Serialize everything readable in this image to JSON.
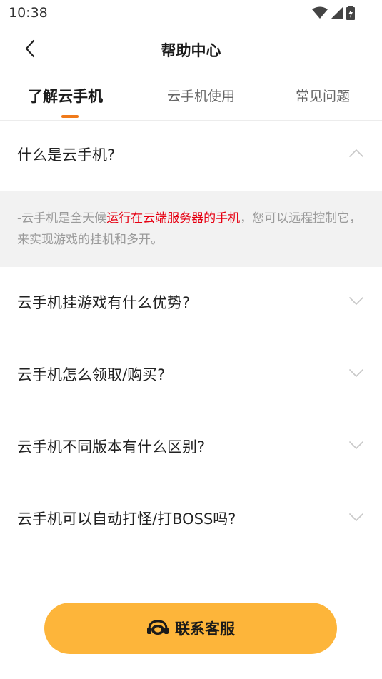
{
  "status_bar": {
    "time": "10:38"
  },
  "nav": {
    "title": "帮助中心"
  },
  "tabs": [
    {
      "label": "了解云手机",
      "active": true
    },
    {
      "label": "云手机使用",
      "active": false
    },
    {
      "label": "常见问题",
      "active": false
    }
  ],
  "faq": [
    {
      "question": "什么是云手机?",
      "expanded": true,
      "answer": {
        "prefix": "-云手机是全天候",
        "highlight": "运行在云端服务器的手机",
        "suffix": "，您可以远程控制它，来实现游戏的挂机和多开。"
      }
    },
    {
      "question": "云手机挂游戏有什么优势?",
      "expanded": false
    },
    {
      "question": "云手机怎么领取/购买?",
      "expanded": false
    },
    {
      "question": "云手机不同版本有什么区别?",
      "expanded": false
    },
    {
      "question": "云手机可以自动打怪/打BOSS吗?",
      "expanded": false
    }
  ],
  "contact": {
    "label": "联系客服"
  },
  "colors": {
    "accent": "#f07a1a",
    "button": "#fdb53a",
    "highlight": "#e60012"
  },
  "icons": [
    "back-arrow-icon",
    "wifi-icon",
    "signal-icon",
    "battery-icon",
    "chevron-up-icon",
    "chevron-down-icon",
    "headset-icon"
  ]
}
